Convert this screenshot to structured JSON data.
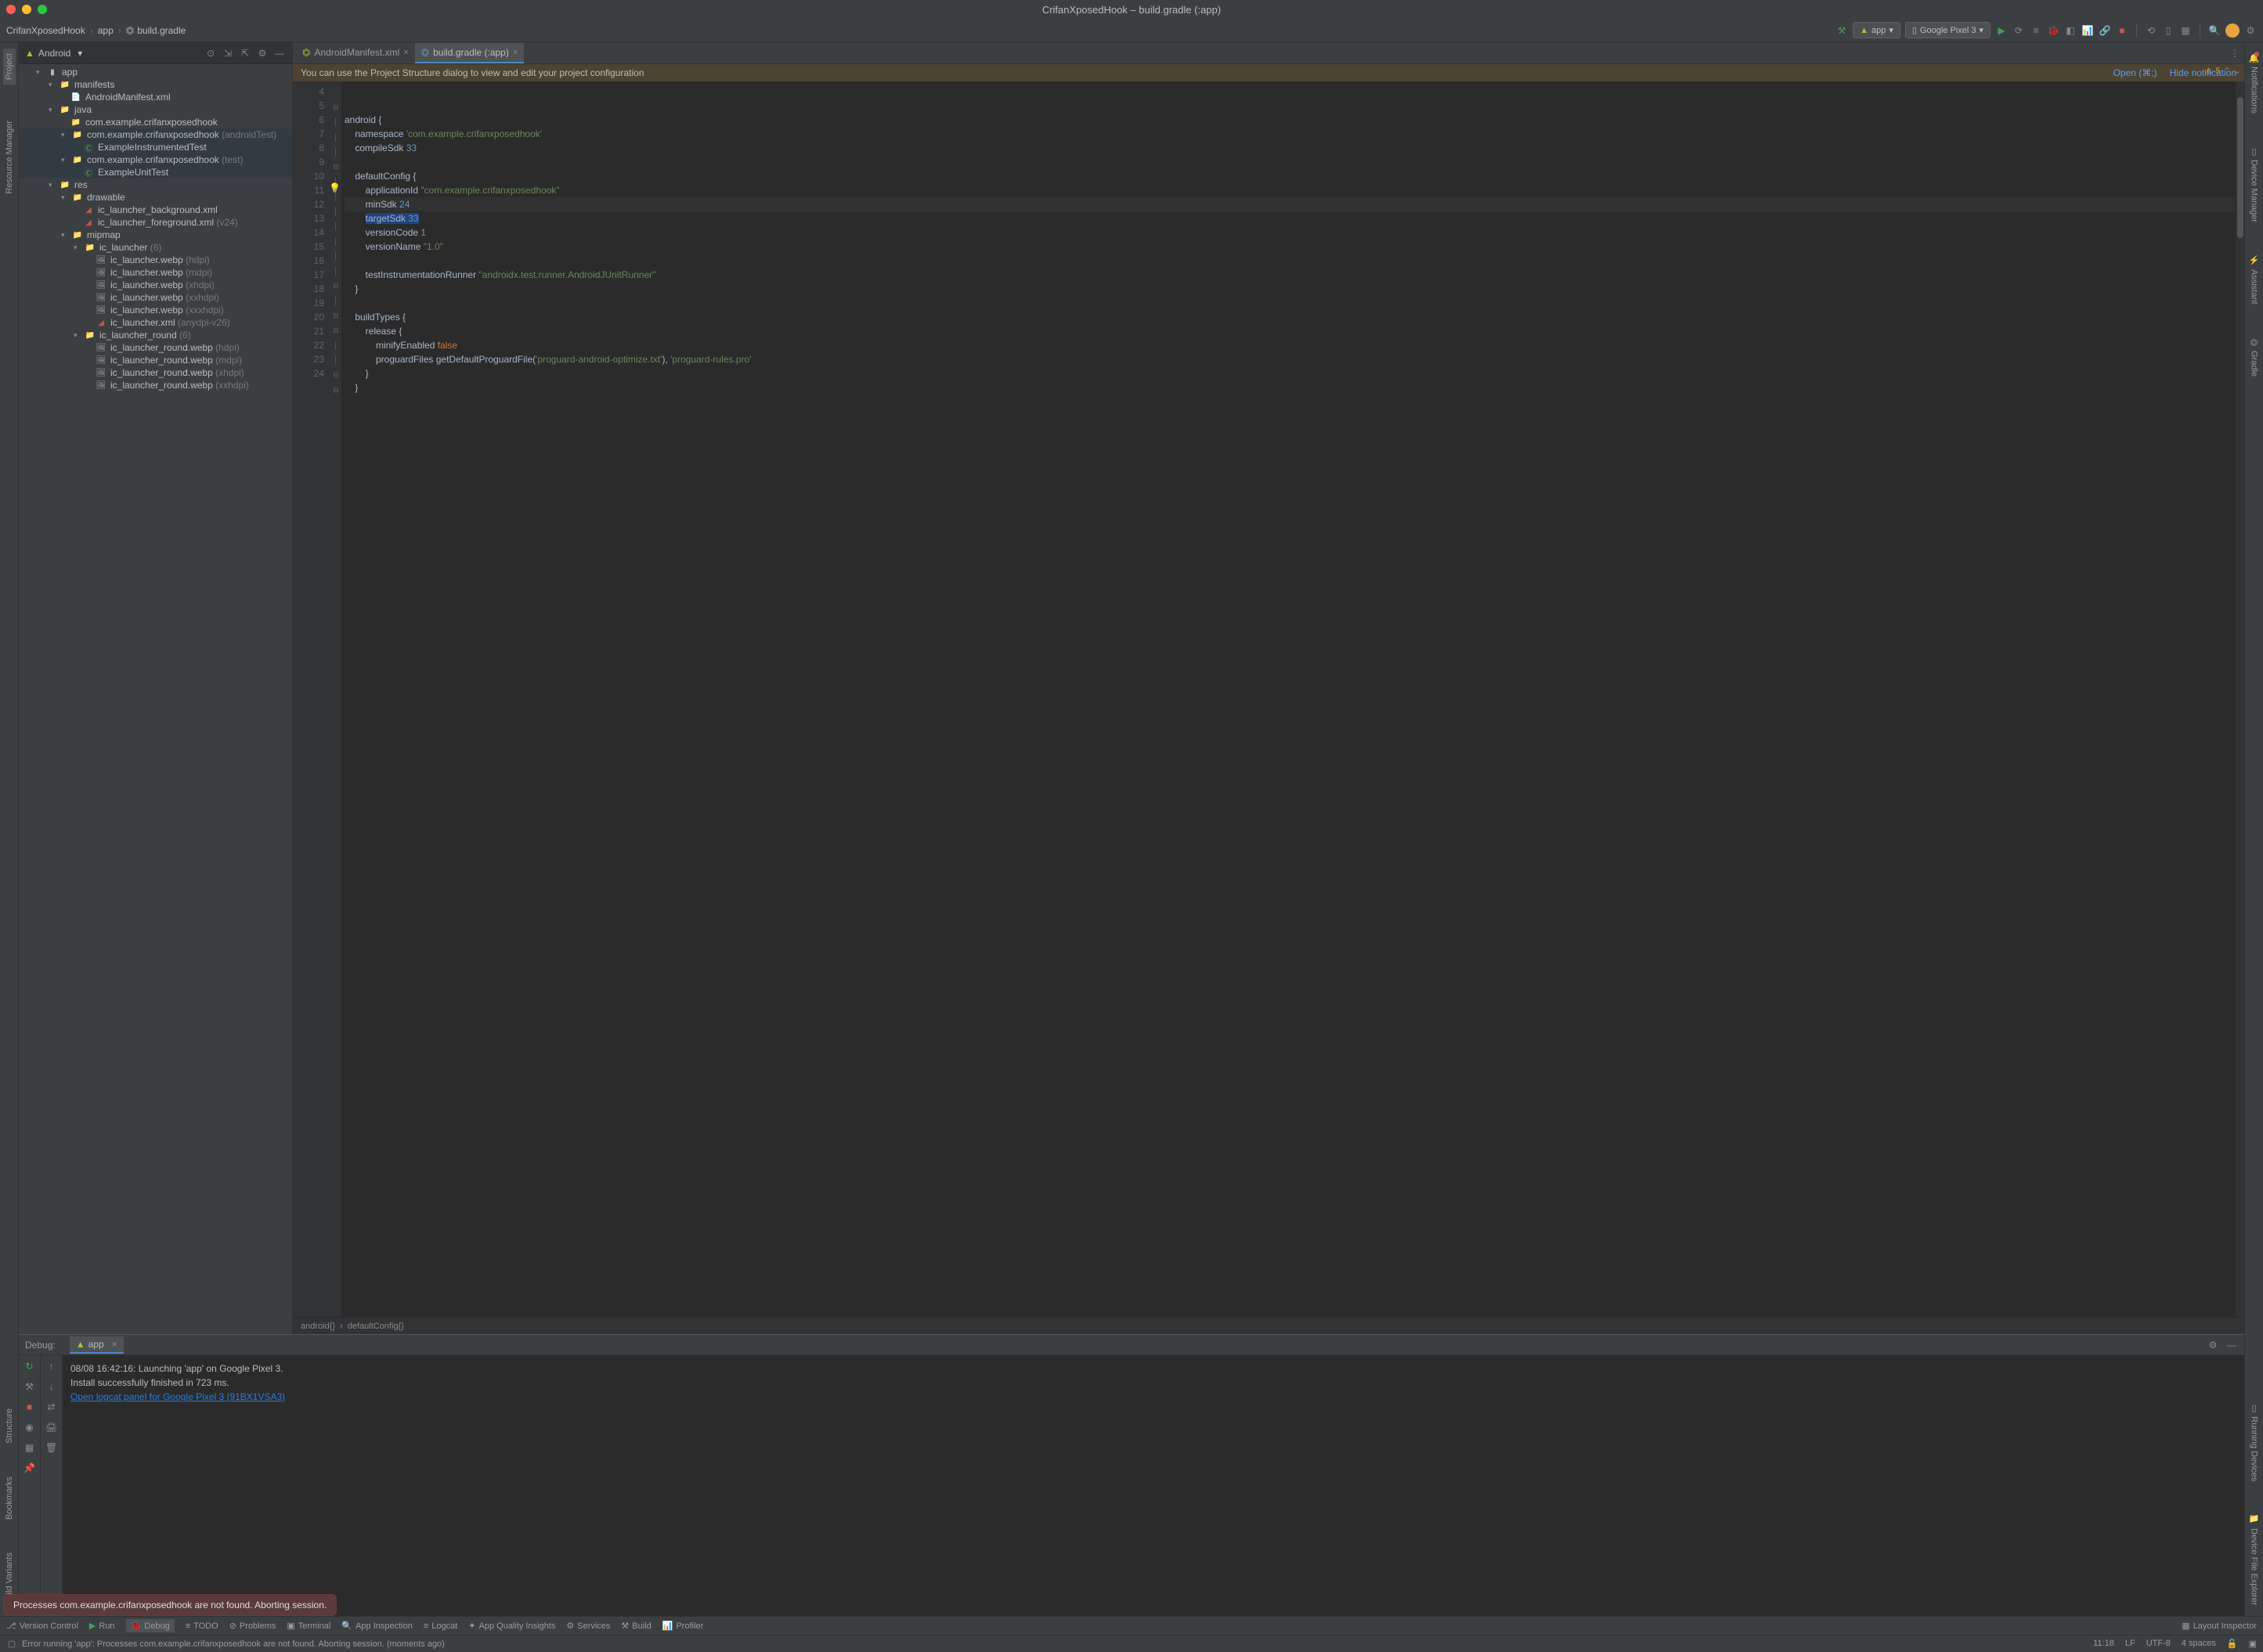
{
  "window": {
    "title": "CrifanXposedHook – build.gradle (:app)"
  },
  "breadcrumb": {
    "root": "CrifanXposedHook",
    "sep": "›",
    "p1": "app",
    "p2": "build.gradle"
  },
  "toolbar": {
    "config": "app",
    "device": "Google Pixel 3"
  },
  "leftTabs": {
    "project": "Project",
    "resource": "Resource Manager"
  },
  "leftBotTabs": {
    "structure": "Structure",
    "bookmarks": "Bookmarks",
    "build": "Build Variants"
  },
  "rightTabs": {
    "notifications": "Notifications",
    "device": "Device Manager",
    "assistant": "Assistant",
    "gradle": "Gradle",
    "running": "Running Devices",
    "explorer": "Device File Explorer"
  },
  "projectPanel": {
    "title": "Android"
  },
  "tree": {
    "app": "app",
    "manifests": "manifests",
    "androidManifest": "AndroidManifest.xml",
    "java": "java",
    "pkg1": "com.example.crifanxposedhook",
    "pkg2": "com.example.crifanxposedhook",
    "pkg2_qual": " (androidTest)",
    "exInst": "ExampleInstrumentedTest",
    "pkg3": "com.example.crifanxposedhook",
    "pkg3_qual": " (test)",
    "exUnit": "ExampleUnitTest",
    "res": "res",
    "drawable": "drawable",
    "icbg": "ic_launcher_background.xml",
    "icfg": "ic_launcher_foreground.xml",
    "icfg_qual": " (v24)",
    "mipmap": "mipmap",
    "ic_launcher": "ic_launcher",
    "ic_launcher_qual": " (6)",
    "webp_h": "ic_launcher.webp",
    "h_q": " (hdpi)",
    "webp_m": "ic_launcher.webp",
    "m_q": " (mdpi)",
    "webp_x": "ic_launcher.webp",
    "x_q": " (xhdpi)",
    "webp_xx": "ic_launcher.webp",
    "xx_q": " (xxhdpi)",
    "webp_xxx": "ic_launcher.webp",
    "xxx_q": " (xxxhdpi)",
    "icxml": "ic_launcher.xml",
    "icxml_q": " (anydpi-v26)",
    "ic_round": "ic_launcher_round",
    "ic_round_q": " (6)",
    "r_h": "ic_launcher_round.webp",
    "r_h_q": " (hdpi)",
    "r_m": "ic_launcher_round.webp",
    "r_m_q": " (mdpi)",
    "r_x": "ic_launcher_round.webp",
    "r_x_q": " (xhdpi)",
    "r_xx": "ic_launcher_round.webp",
    "r_xx_q": " (xxhdpi)"
  },
  "editorTabs": {
    "t1": "AndroidManifest.xml",
    "t2": "build.gradle (:app)"
  },
  "notif": {
    "msg": "You can use the Project Structure dialog to view and edit your project configuration",
    "open": "Open (⌘;)",
    "hide": "Hide notification"
  },
  "warnCount": "5",
  "code": {
    "l5": {
      "kw": "android",
      "br": " {"
    },
    "l6": {
      "id": "namespace ",
      "str": "'com.example.crifanxposedhook'"
    },
    "l7": {
      "id": "compileSdk ",
      "num": "33"
    },
    "l9": {
      "id": "defaultConfig",
      "br": " {"
    },
    "l10": {
      "id": "applicationId ",
      "str": "\"com.example.crifanxposedhook\""
    },
    "l11": {
      "id": "minSdk ",
      "num": "24"
    },
    "l12": {
      "id": "targetSdk ",
      "num": "33"
    },
    "l13": {
      "id": "versionCode ",
      "num": "1"
    },
    "l14": {
      "id": "versionName ",
      "str": "\"1.0\""
    },
    "l16": {
      "id": "testInstrumentationRunner ",
      "str": "\"androidx.test.runner.AndroidJUnitRunner\""
    },
    "l19": {
      "id": "buildTypes",
      "br": " {"
    },
    "l20": {
      "id": "release",
      "br": " {"
    },
    "l21": {
      "id": "minifyEnabled ",
      "kw": "false"
    },
    "l22": {
      "id": "proguardFiles ",
      "fn": "getDefaultProguardFile(",
      "str1": "'proguard-android-optimize.txt'",
      "mid": "), ",
      "str2": "'proguard-rules.pro'"
    }
  },
  "breadcrumb2": {
    "a": "android{}",
    "sep": "›",
    "b": "defaultConfig{}"
  },
  "debug": {
    "headerLabel": "Debug:",
    "tab": "app",
    "l1": "08/08 16:42:16: Launching 'app' on Google Pixel 3.",
    "l2": "Install successfully finished in 723 ms.",
    "l3": "Open logcat panel for Google Pixel 3 (91BX1VSA3)"
  },
  "toast": "Processes com.example.crifanxposedhook are not found. Aborting session.",
  "bottomBar": {
    "vc": "Version Control",
    "run": "Run",
    "debug": "Debug",
    "todo": "TODO",
    "problems": "Problems",
    "terminal": "Terminal",
    "appinsp": "App Inspection",
    "logcat": "Logcat",
    "aqi": "App Quality Insights",
    "services": "Services",
    "build": "Build",
    "profiler": "Profiler",
    "layout": "Layout Inspector"
  },
  "status": {
    "msg": "Error running 'app': Processes com.example.crifanxposedhook are not found. Aborting session. (moments ago)",
    "pos": "11:18",
    "lf": "LF",
    "enc": "UTF-8",
    "indent": "4 spaces"
  }
}
